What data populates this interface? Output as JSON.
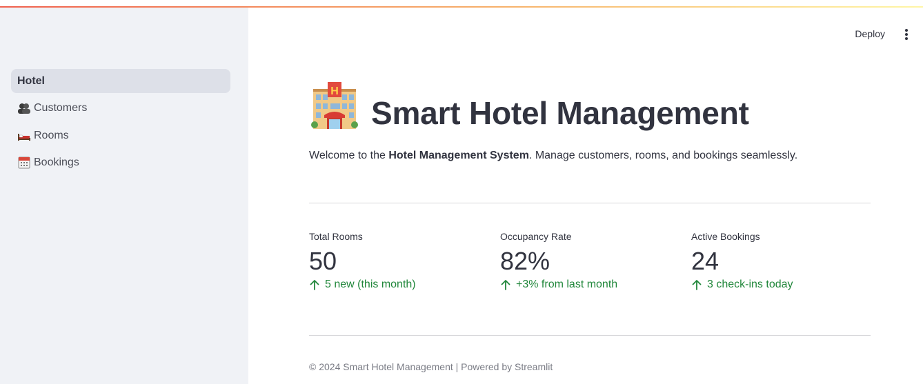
{
  "sidebar": {
    "items": [
      {
        "label": "Hotel",
        "icon": ""
      },
      {
        "label": "Customers",
        "icon": "people-icon"
      },
      {
        "label": "Rooms",
        "icon": "bed-icon"
      },
      {
        "label": "Bookings",
        "icon": "calendar-icon"
      }
    ]
  },
  "header": {
    "deploy_label": "Deploy",
    "menu_icon": "more-vertical-icon"
  },
  "main": {
    "title_icon": "hotel-icon",
    "title": "Smart Hotel Management",
    "welcome": {
      "prefix": "Welcome to the ",
      "bold": "Hotel Management System",
      "suffix": ". Manage customers, rooms, and bookings seamlessly."
    },
    "metrics": [
      {
        "label": "Total Rooms",
        "value": "50",
        "delta": "5 new (this month)"
      },
      {
        "label": "Occupancy Rate",
        "value": "82%",
        "delta": "+3% from last month"
      },
      {
        "label": "Active Bookings",
        "value": "24",
        "delta": "3 check-ins today"
      }
    ],
    "footer": "© 2024 Smart Hotel Management | Powered by Streamlit"
  },
  "colors": {
    "sidebar_bg": "#f0f2f6",
    "active_nav_bg": "#dde0e8",
    "text": "#31333f",
    "delta_green": "#21873b",
    "divider": "#d6d6d9",
    "footer_text": "#7a7c85"
  }
}
